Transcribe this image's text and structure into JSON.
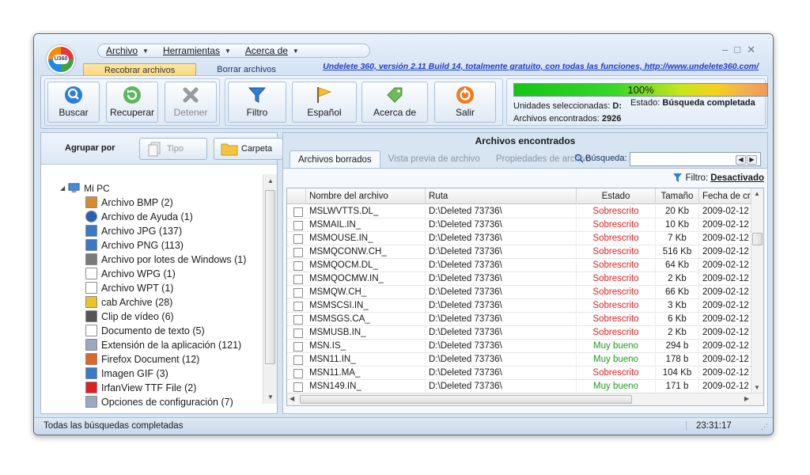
{
  "menu": [
    {
      "label": "Archivo"
    },
    {
      "label": "Herramientas"
    },
    {
      "label": "Acerca de"
    }
  ],
  "tabs": [
    "Recobrar archivos",
    "Borrar archivos"
  ],
  "promo": "Undelete 360, versión 2.11 Build 14, totalmente gratuito, con todas las funciones, http://www.undelete360.com/",
  "logo_text": "U360",
  "toolbar": {
    "buscar": "Buscar",
    "recuperar": "Recuperar",
    "detener": "Detener",
    "filtro": "Filtro",
    "idioma": "Español",
    "acerca": "Acerca de",
    "salir": "Salir"
  },
  "status": {
    "progress_text": "100%",
    "progress_value": 100,
    "unidades_label": "Unidades seleccionadas:",
    "unidades_value": "D:",
    "estado_label": "Estado:",
    "estado_value": "Búsqueda completada",
    "archivos_label": "Archivos encontrados:",
    "archivos_value": "2926"
  },
  "left": {
    "group_label": "Agrupar por",
    "tipo": "Tipo",
    "carpeta": "Carpeta",
    "root": "Mi PC",
    "items": [
      {
        "label": "Archivo BMP (2)",
        "icon": "bmp-icon",
        "color": "#d98b2b"
      },
      {
        "label": "Archivo de Ayuda (1)",
        "icon": "help-icon",
        "color": "#2a5fb8"
      },
      {
        "label": "Archivo JPG (137)",
        "icon": "jpg-icon",
        "color": "#3a78c8"
      },
      {
        "label": "Archivo PNG (113)",
        "icon": "png-icon",
        "color": "#3a78c8"
      },
      {
        "label": "Archivo por lotes de Windows (1)",
        "icon": "batch-icon",
        "color": "#7a7a7a"
      },
      {
        "label": "Archivo WPG (1)",
        "icon": "file-icon",
        "color": "#ffffff"
      },
      {
        "label": "Archivo WPT (1)",
        "icon": "file-icon",
        "color": "#ffffff"
      },
      {
        "label": "cab Archive (28)",
        "icon": "cab-icon",
        "color": "#e8c42a"
      },
      {
        "label": "Clip de vídeo (6)",
        "icon": "video-icon",
        "color": "#555555"
      },
      {
        "label": "Documento de texto (5)",
        "icon": "text-file-icon",
        "color": "#ffffff"
      },
      {
        "label": "Extensión de la aplicación (121)",
        "icon": "dll-icon",
        "color": "#9aa8c0"
      },
      {
        "label": "Firefox Document (12)",
        "icon": "firefox-icon",
        "color": "#e0642a"
      },
      {
        "label": "Imagen GIF (3)",
        "icon": "gif-icon",
        "color": "#3a78c8"
      },
      {
        "label": "IrfanView TTF File (2)",
        "icon": "irfanview-icon",
        "color": "#e02020"
      },
      {
        "label": "Opciones de configuración (7)",
        "icon": "settings-file-icon",
        "color": "#9aa8c0"
      }
    ]
  },
  "right": {
    "title": "Archivos encontrados",
    "tabs": [
      "Archivos borrados",
      "Vista previa de archivo",
      "Propiedades de archivo"
    ],
    "search_label": "Búsqueda:",
    "search_value": "",
    "filter_label": "Filtro:",
    "filter_value": "Desactivado",
    "columns": [
      "Nombre del archivo",
      "Ruta",
      "Estado",
      "Tamaño",
      "Fecha de cr"
    ],
    "rows": [
      {
        "name": "MSLWVTTS.DL_",
        "path": "D:\\Deleted 73736\\",
        "state": "Sobrescrito",
        "size": "20 Kb",
        "date": "2009-02-12"
      },
      {
        "name": "MSMAIL.IN_",
        "path": "D:\\Deleted 73736\\",
        "state": "Sobrescrito",
        "size": "10 Kb",
        "date": "2009-02-12"
      },
      {
        "name": "MSMOUSE.IN_",
        "path": "D:\\Deleted 73736\\",
        "state": "Sobrescrito",
        "size": "7 Kb",
        "date": "2009-02-12"
      },
      {
        "name": "MSMQCONW.CH_",
        "path": "D:\\Deleted 73736\\",
        "state": "Sobrescrito",
        "size": "516 Kb",
        "date": "2009-02-12"
      },
      {
        "name": "MSMQOCM.DL_",
        "path": "D:\\Deleted 73736\\",
        "state": "Sobrescrito",
        "size": "64 Kb",
        "date": "2009-02-12"
      },
      {
        "name": "MSMQOCMW.IN_",
        "path": "D:\\Deleted 73736\\",
        "state": "Sobrescrito",
        "size": "2 Kb",
        "date": "2009-02-12"
      },
      {
        "name": "MSMQW.CH_",
        "path": "D:\\Deleted 73736\\",
        "state": "Sobrescrito",
        "size": "66 Kb",
        "date": "2009-02-12"
      },
      {
        "name": "MSMSCSI.IN_",
        "path": "D:\\Deleted 73736\\",
        "state": "Sobrescrito",
        "size": "3 Kb",
        "date": "2009-02-12"
      },
      {
        "name": "MSMSGS.CA_",
        "path": "D:\\Deleted 73736\\",
        "state": "Sobrescrito",
        "size": "6 Kb",
        "date": "2009-02-12"
      },
      {
        "name": "MSMUSB.IN_",
        "path": "D:\\Deleted 73736\\",
        "state": "Sobrescrito",
        "size": "2 Kb",
        "date": "2009-02-12"
      },
      {
        "name": "MSN.IS_",
        "path": "D:\\Deleted 73736\\",
        "state": "Muy bueno",
        "size": "294 b",
        "date": "2009-02-12"
      },
      {
        "name": "MSN11.IN_",
        "path": "D:\\Deleted 73736\\",
        "state": "Muy bueno",
        "size": "178 b",
        "date": "2009-02-12"
      },
      {
        "name": "MSN11.MA_",
        "path": "D:\\Deleted 73736\\",
        "state": "Sobrescrito",
        "size": "104 Kb",
        "date": "2009-02-12"
      },
      {
        "name": "MSN149.IN_",
        "path": "D:\\Deleted 73736\\",
        "state": "Muy bueno",
        "size": "171 b",
        "date": "2009-02-12"
      }
    ],
    "state_colors": {
      "Sobrescrito": "#e02020",
      "Muy bueno": "#1f9a1f"
    }
  },
  "statusbar": {
    "text": "Todas las búsquedas completadas",
    "time": "23:31:17"
  }
}
